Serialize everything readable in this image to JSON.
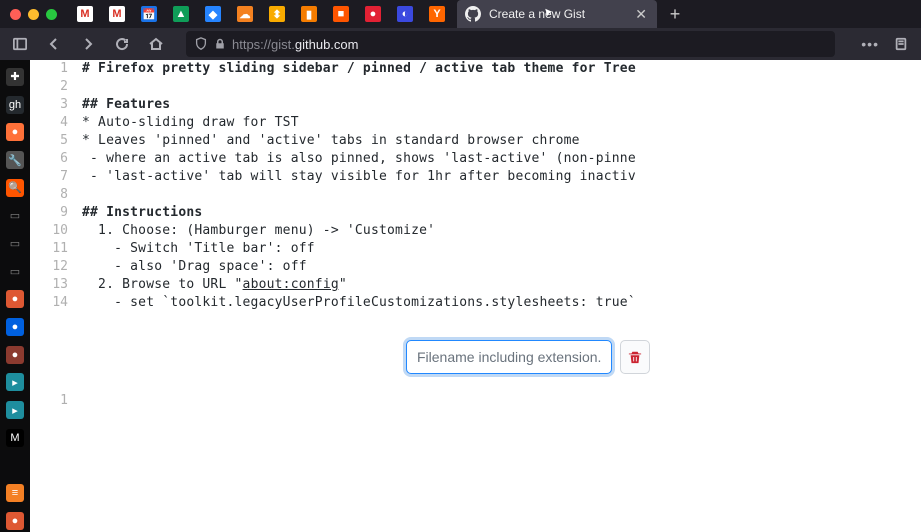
{
  "browser": {
    "tabs": {
      "active": {
        "title": "Create a new Gist"
      }
    },
    "url": {
      "scheme": "https://",
      "sub": "gist.",
      "domain": "github.com"
    }
  },
  "pinned_icons": [
    {
      "bg": "#ffffff",
      "fg": "#d93025",
      "txt": "M"
    },
    {
      "bg": "#ffffff",
      "fg": "#d93025",
      "txt": "M"
    },
    {
      "bg": "#1a73e8",
      "fg": "#fff",
      "txt": "📅"
    },
    {
      "bg": "#0f9d58",
      "fg": "#fff",
      "txt": "▲"
    },
    {
      "bg": "#2684ff",
      "fg": "#fff",
      "txt": "◆"
    },
    {
      "bg": "#f48120",
      "fg": "#fff",
      "txt": "☁"
    },
    {
      "bg": "#f9ab00",
      "fg": "#fff",
      "txt": "⬍"
    },
    {
      "bg": "#f57c00",
      "fg": "#fff",
      "txt": "▮"
    },
    {
      "bg": "#ff5500",
      "fg": "#fff",
      "txt": "■"
    },
    {
      "bg": "#e22134",
      "fg": "#fff",
      "txt": "●"
    },
    {
      "bg": "#3b49df",
      "fg": "#fff",
      "txt": "◐"
    },
    {
      "bg": "#ff6600",
      "fg": "#fff",
      "txt": "Y"
    }
  ],
  "sidebar_icons": [
    {
      "bg": "#333",
      "fg": "#fff",
      "txt": "✚"
    },
    {
      "bg": "#24292e",
      "fg": "#fff",
      "txt": "gh"
    },
    {
      "bg": "#ff7139",
      "fg": "#fff",
      "txt": "●"
    },
    {
      "bg": "#555",
      "fg": "#ddd",
      "txt": "🔧"
    },
    {
      "bg": "#ff5500",
      "fg": "#fff",
      "txt": "🔍"
    },
    {
      "bg": "",
      "fg": "#888",
      "txt": "▭"
    },
    {
      "bg": "",
      "fg": "#888",
      "txt": "▭"
    },
    {
      "bg": "",
      "fg": "#888",
      "txt": "▭"
    },
    {
      "bg": "#de5833",
      "fg": "#fff",
      "txt": "●"
    },
    {
      "bg": "#0060df",
      "fg": "#fff",
      "txt": "●"
    },
    {
      "bg": "#8b3a2f",
      "fg": "#fff",
      "txt": "●"
    },
    {
      "bg": "#1e8e9e",
      "fg": "#fff",
      "txt": "▸"
    },
    {
      "bg": "#1e8e9e",
      "fg": "#fff",
      "txt": "▸"
    },
    {
      "bg": "#000",
      "fg": "#fff",
      "txt": "M"
    },
    {
      "bg": "",
      "fg": "",
      "txt": ""
    },
    {
      "bg": "#f48024",
      "fg": "#fff",
      "txt": "≡"
    },
    {
      "bg": "#de5833",
      "fg": "#fff",
      "txt": "●"
    }
  ],
  "code": {
    "lines": [
      "# Firefox pretty sliding sidebar / pinned / active tab theme for Tree ",
      "",
      "## Features",
      "* Auto-sliding draw for TST",
      "* Leaves 'pinned' and 'active' tabs in standard browser chrome",
      " - where an active tab is also pinned, shows 'last-active' (non-pinne",
      " - 'last-active' tab will stay visible for 1hr after becoming inactiv",
      "",
      "## Instructions",
      "  1. Choose: (Hamburger menu) -> 'Customize'",
      "    - Switch 'Title bar': off",
      "    - also 'Drag space': off",
      "  2. Browse to URL \"about:config\"",
      "    - set `toolkit.legacyUserProfileCustomizations.stylesheets: true`"
    ]
  },
  "file2": {
    "placeholder": "Filename including extension..",
    "line1": ""
  }
}
